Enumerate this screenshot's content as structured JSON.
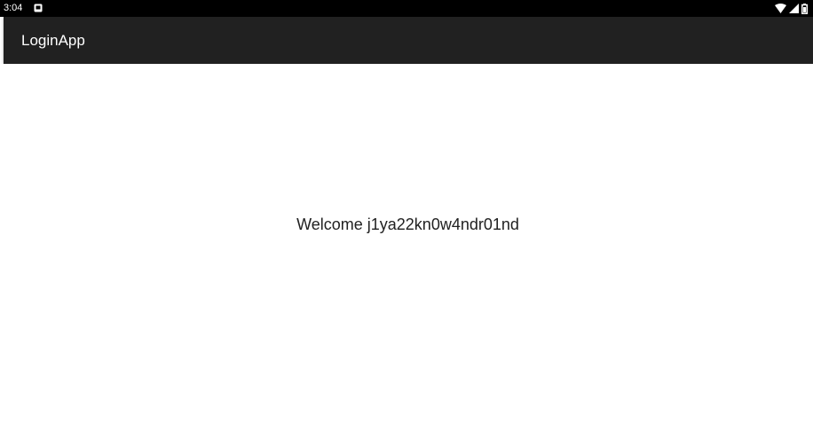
{
  "status_bar": {
    "time": "3:04",
    "notification_icon": "notification-square-icon",
    "wifi_icon": "wifi-icon",
    "signal_icon": "cell-signal-icon",
    "battery_icon": "battery-icon"
  },
  "app_bar": {
    "title": "LoginApp",
    "background": "#212121"
  },
  "main": {
    "welcome_text": "Welcome j1ya22kn0w4ndr01nd"
  }
}
